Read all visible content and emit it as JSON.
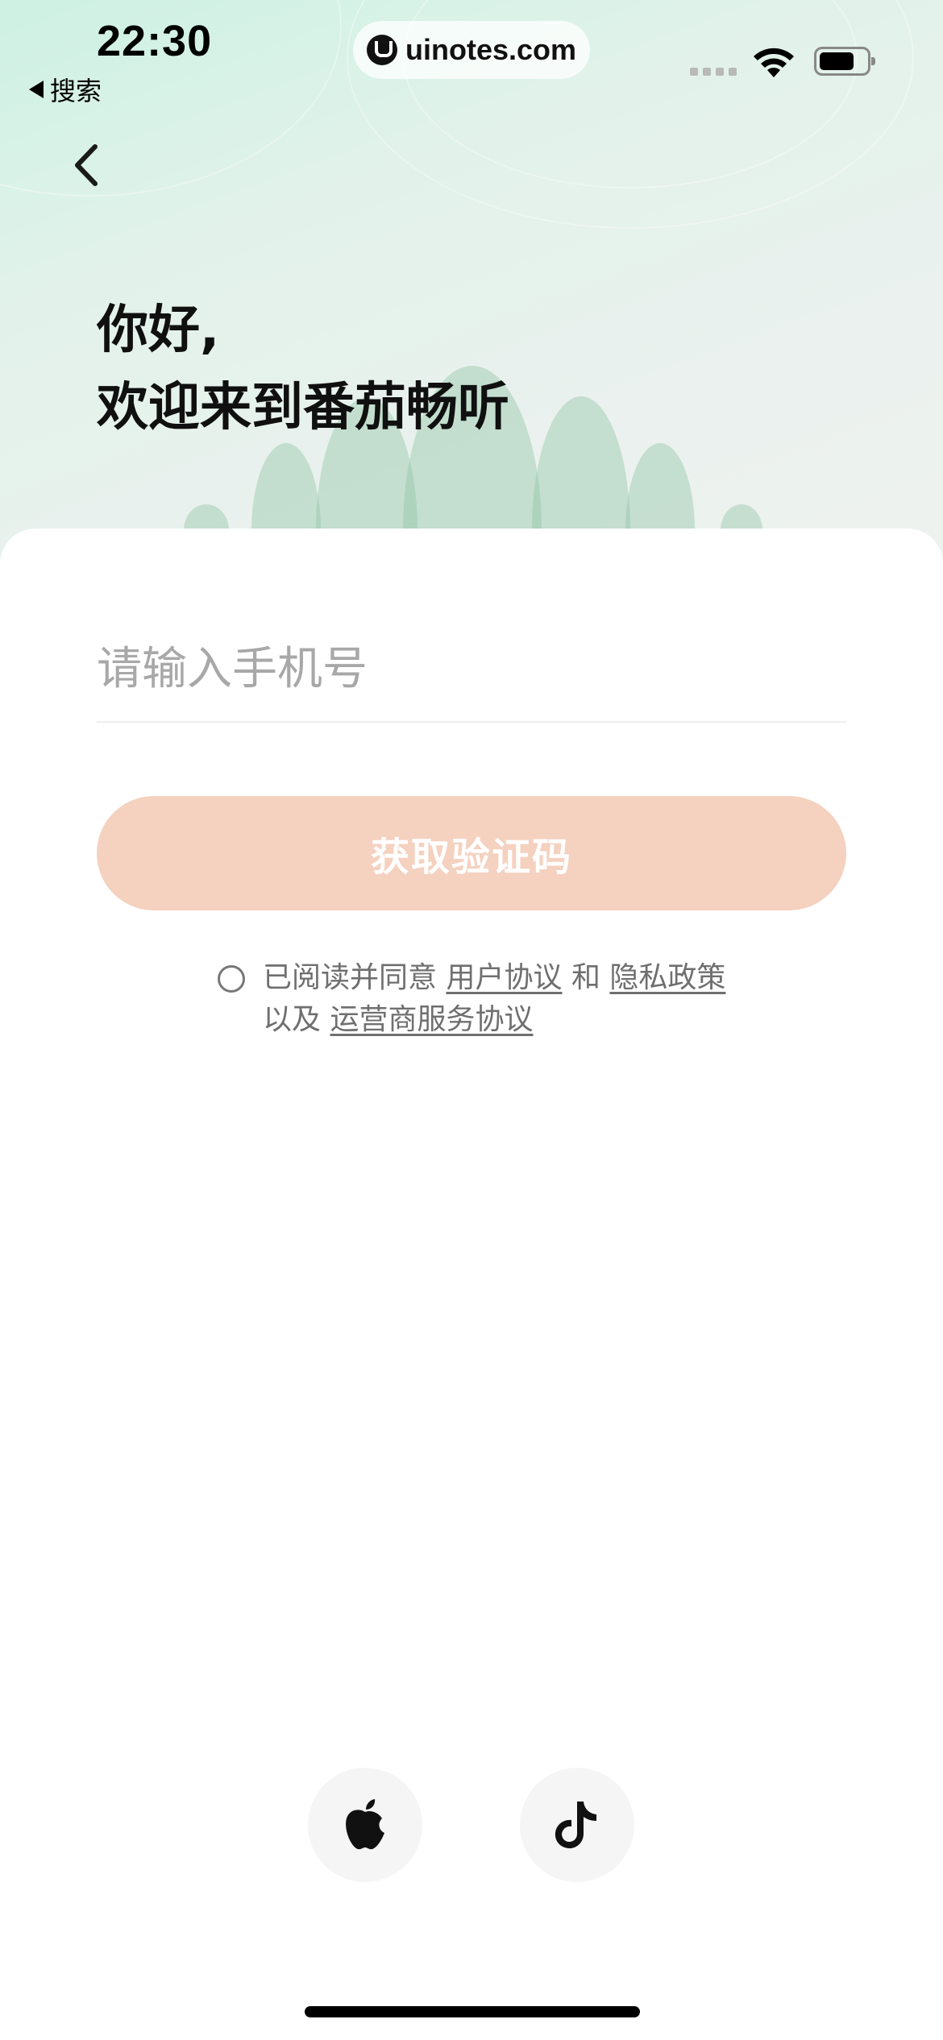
{
  "status_bar": {
    "time": "22:30",
    "back_app": "搜索",
    "url": "uinotes.com"
  },
  "header": {
    "greeting_line1": "你好,",
    "greeting_line2": "欢迎来到番茄畅听"
  },
  "login_form": {
    "phone_placeholder": "请输入手机号",
    "phone_value": "",
    "get_code_label": "获取验证码",
    "button_color": "#f5d1c0"
  },
  "agreement": {
    "prefix": "已阅读并同意",
    "user_agreement": "用户协议",
    "and": "和",
    "privacy_policy": "隐私政策",
    "also": "以及",
    "carrier_agreement": "运营商服务协议",
    "checked": false
  },
  "social_login": {
    "apple_icon": "apple-icon",
    "douyin_icon": "douyin-icon"
  },
  "colors": {
    "hero_top": "#cdf1e3",
    "hero_bottom": "#eef2ef",
    "hills": "#8fc4a5"
  }
}
